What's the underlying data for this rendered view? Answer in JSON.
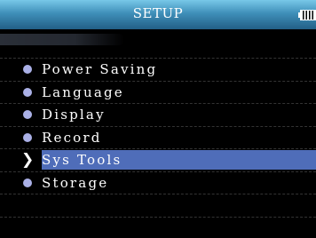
{
  "header": {
    "title": "SETUP",
    "battery_icon": "battery-full-icon"
  },
  "menu": {
    "items": [
      {
        "label": "Power Saving",
        "icon": "bullet-icon",
        "selected": false
      },
      {
        "label": "Language",
        "icon": "bullet-icon",
        "selected": false
      },
      {
        "label": "Display",
        "icon": "bullet-icon",
        "selected": false
      },
      {
        "label": "Record",
        "icon": "bullet-icon",
        "selected": false
      },
      {
        "label": "Sys Tools",
        "icon": "arrow-right-icon",
        "selected": true
      },
      {
        "label": "Storage",
        "icon": "bullet-icon",
        "selected": false
      }
    ]
  },
  "colors": {
    "title_bar_top": "#78c8e8",
    "title_bar_bottom": "#225f86",
    "bullet": "#aab0e6",
    "highlight": "#4f6db9",
    "background": "#000000"
  }
}
